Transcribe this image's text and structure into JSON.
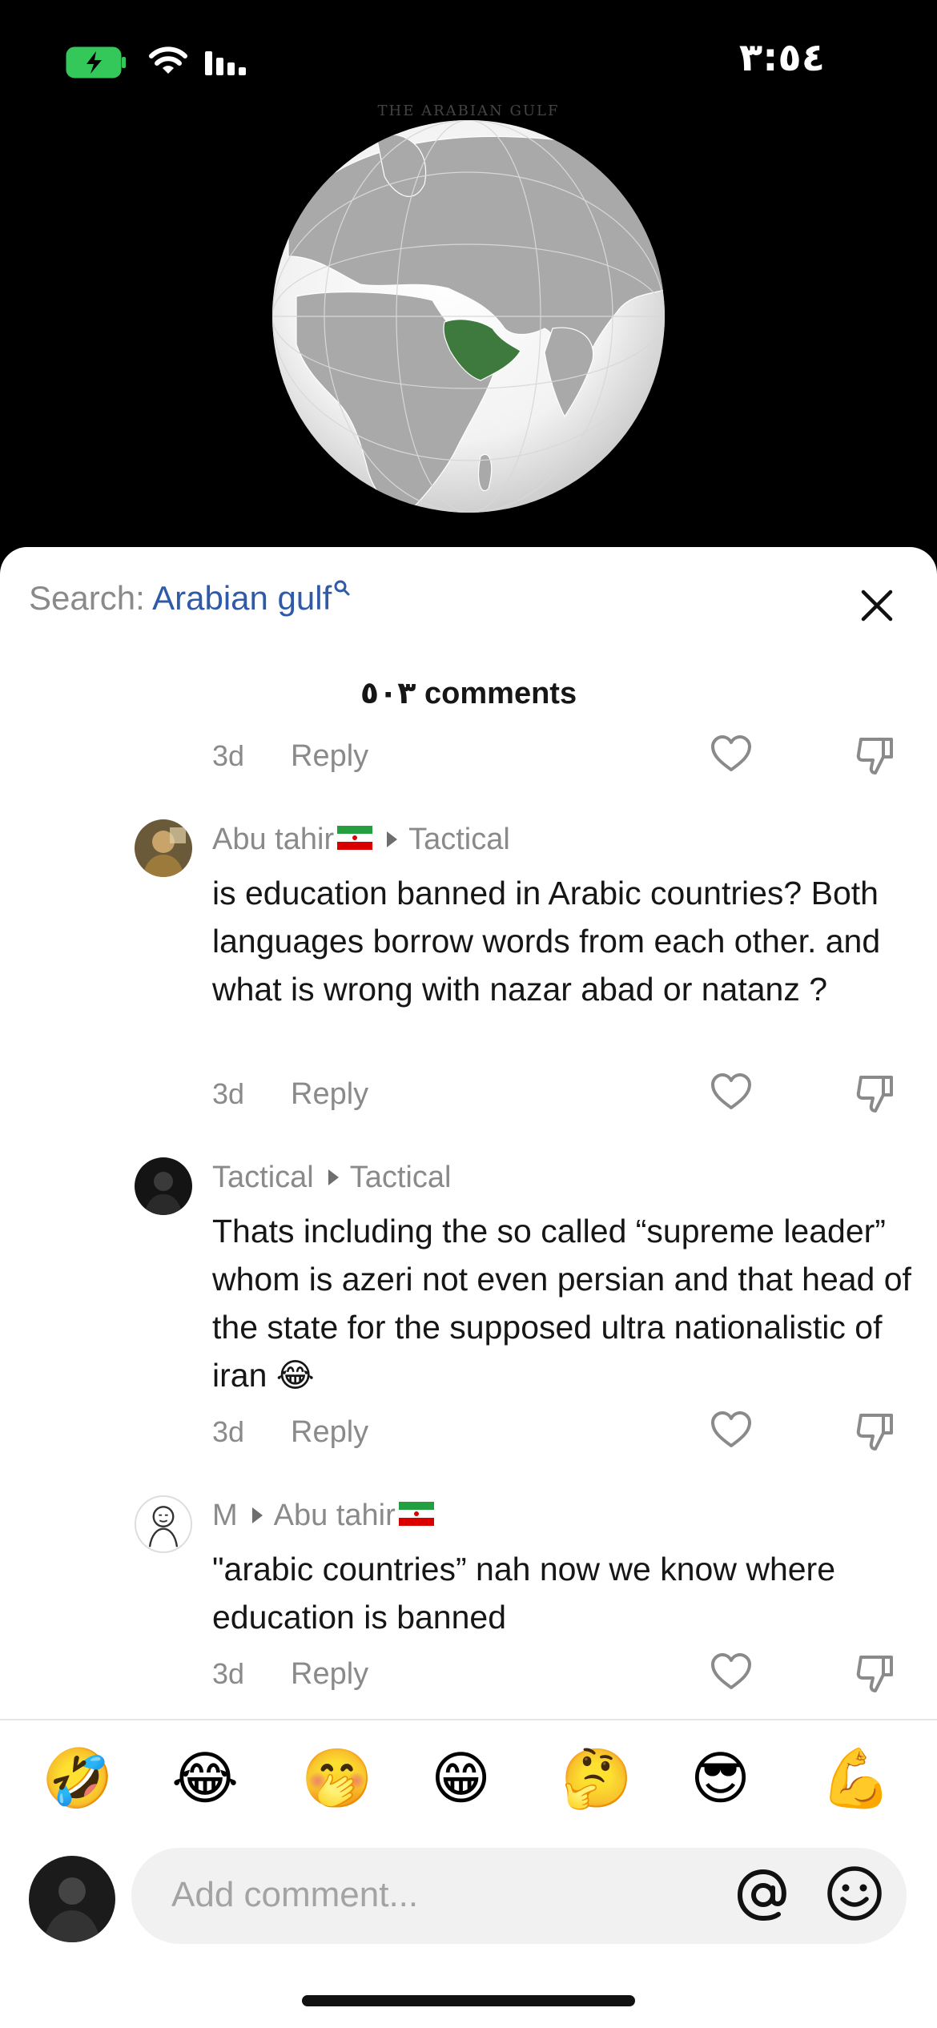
{
  "status_bar": {
    "time": "٣:٥٤"
  },
  "video": {
    "caption": "THE ARABIAN GULF"
  },
  "search": {
    "prefix": "Search: ",
    "query": "Arabian gulf"
  },
  "comments_count": "٥٠٣ comments",
  "top_meta": {
    "age": "3d",
    "reply": "Reply"
  },
  "comments": [
    {
      "author": "Abu tahir",
      "author_flag": "iran-flag",
      "reply_to": "Tactical",
      "text": "is education banned in Arabic countries? Both languages borrow words from each other. and what is wrong with nazar abad or natanz ?",
      "age": "3d",
      "reply": "Reply"
    },
    {
      "author": "Tactical",
      "reply_to": "Tactical",
      "text": "Thats including the so called “supreme leader” whom is azeri not even persian and that head of the state for the supposed ultra nationalistic of iran 😂",
      "age": "3d",
      "reply": "Reply"
    },
    {
      "author": "M",
      "reply_to": "Abu tahir",
      "reply_to_flag": "iran-flag",
      "text": "\"arabic countries” nah now we know where education is banned",
      "age": "3d",
      "reply": "Reply"
    }
  ],
  "emoji_bar": [
    "🤣",
    "😂",
    "🤭",
    "😁",
    "🤔",
    "😎",
    "💪"
  ],
  "composer": {
    "placeholder": "Add comment..."
  },
  "colors": {
    "accent": "#2e5aa8",
    "muted": "#8a8a8a",
    "highlight_region": "#3e7a3e"
  }
}
